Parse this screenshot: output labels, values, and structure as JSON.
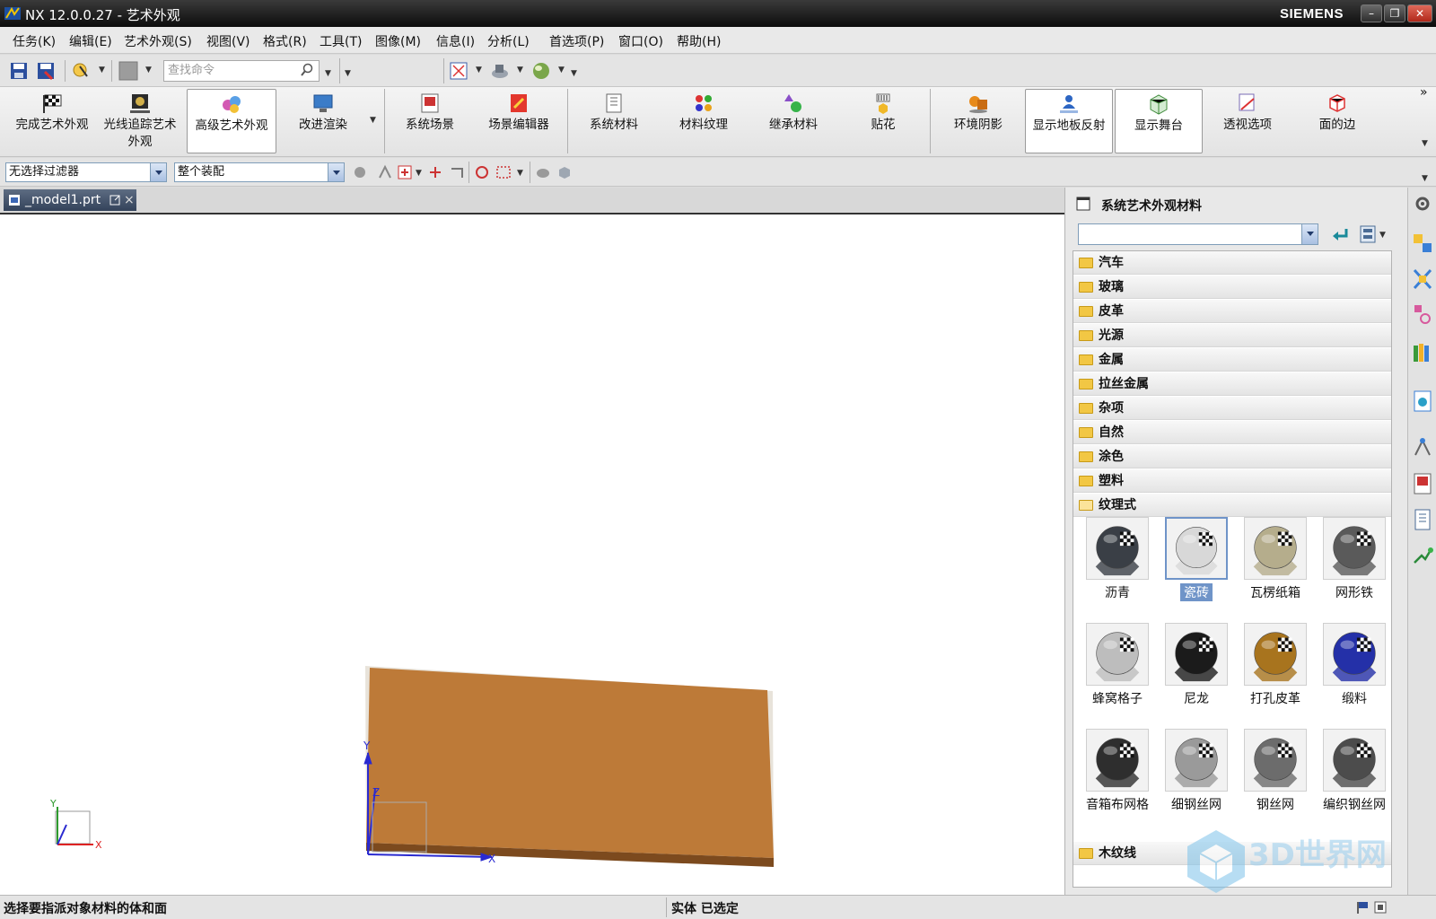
{
  "window": {
    "title": "NX 12.0.0.27 - 艺术外观",
    "brand": "SIEMENS",
    "minimize": "–",
    "restore": "❐",
    "close": "✕"
  },
  "menubar": {
    "items": [
      "任务(K)",
      "编辑(E)",
      "艺术外观(S)",
      "视图(V)",
      "格式(R)",
      "工具(T)",
      "图像(M)",
      "信息(I)",
      "分析(L)",
      "首选项(P)",
      "窗口(O)",
      "帮助(H)"
    ]
  },
  "toolbar": {
    "search_placeholder": "查找命令",
    "icons": [
      "save-icon",
      "save-as-icon",
      "select-tool-icon",
      "gray-swatch-icon",
      "fit-view-icon",
      "render-style-icon",
      "material-sphere-icon"
    ]
  },
  "ribbon": {
    "buttons": [
      {
        "label": "完成艺术外观",
        "icon": "checkered-flag-icon"
      },
      {
        "label": "光线追踪艺术外观",
        "icon": "ray-trace-icon"
      },
      {
        "label": "高级艺术外观",
        "icon": "advanced-studio-icon"
      },
      {
        "label": "改进渲染",
        "icon": "improve-render-icon"
      },
      {
        "label": "系统场景",
        "icon": "system-scene-icon"
      },
      {
        "label": "场景编辑器",
        "icon": "scene-editor-icon"
      },
      {
        "label": "系统材料",
        "icon": "system-material-icon"
      },
      {
        "label": "材料纹理",
        "icon": "material-texture-icon"
      },
      {
        "label": "继承材料",
        "icon": "inherit-material-icon"
      },
      {
        "label": "贴花",
        "icon": "decal-icon"
      },
      {
        "label": "环境阴影",
        "icon": "ambient-shadow-icon"
      },
      {
        "label": "显示地板反射",
        "icon": "floor-reflection-icon"
      },
      {
        "label": "显示舞台",
        "icon": "show-stage-icon"
      },
      {
        "label": "透视选项",
        "icon": "perspective-icon"
      },
      {
        "label": "面的边",
        "icon": "face-edges-icon"
      }
    ],
    "more": "»"
  },
  "filterbar": {
    "type_filter": "无选择过滤器",
    "scope": "整个装配"
  },
  "document": {
    "tab_label": "_model1.prt",
    "tab_close": "×"
  },
  "viewport": {
    "axis_x": "X",
    "axis_y": "Y",
    "axis_z": "Z"
  },
  "panel": {
    "title": "系统艺术外观材料",
    "categories_top": [
      "汽车",
      "玻璃",
      "皮革",
      "光源",
      "金属",
      "拉丝金属",
      "杂项",
      "自然",
      "涂色",
      "塑料"
    ],
    "expanded_category": "纹理式",
    "materials": [
      {
        "label": "沥青",
        "color": "#3a3f46",
        "selected": false
      },
      {
        "label": "瓷砖",
        "color": "#d8d8d8",
        "selected": true
      },
      {
        "label": "瓦楞纸箱",
        "color": "#b5ad8c",
        "selected": false
      },
      {
        "label": "网形铁",
        "color": "#5a5a5a",
        "selected": false
      },
      {
        "label": "蜂窝格子",
        "color": "#bdbdbd",
        "selected": false
      },
      {
        "label": "尼龙",
        "color": "#1b1b1b",
        "selected": false
      },
      {
        "label": "打孔皮革",
        "color": "#a8741e",
        "selected": false
      },
      {
        "label": "缎料",
        "color": "#2430a8",
        "selected": false
      },
      {
        "label": "音箱布网格",
        "color": "#2e2e2e",
        "selected": false
      },
      {
        "label": "细钢丝网",
        "color": "#9a9a9a",
        "selected": false
      },
      {
        "label": "钢丝网",
        "color": "#6c6c6c",
        "selected": false
      },
      {
        "label": "编织钢丝网",
        "color": "#4c4c4c",
        "selected": false
      }
    ],
    "bottom_category": "木纹线"
  },
  "statusbar": {
    "prompt": "选择要指派对象材料的体和面",
    "selection": "实体 已选定"
  },
  "watermark": "3D世界网",
  "colors": {
    "part_top": "#bd7a38",
    "part_front": "#7c4a1e",
    "selection_blue": "#6f94c8"
  }
}
